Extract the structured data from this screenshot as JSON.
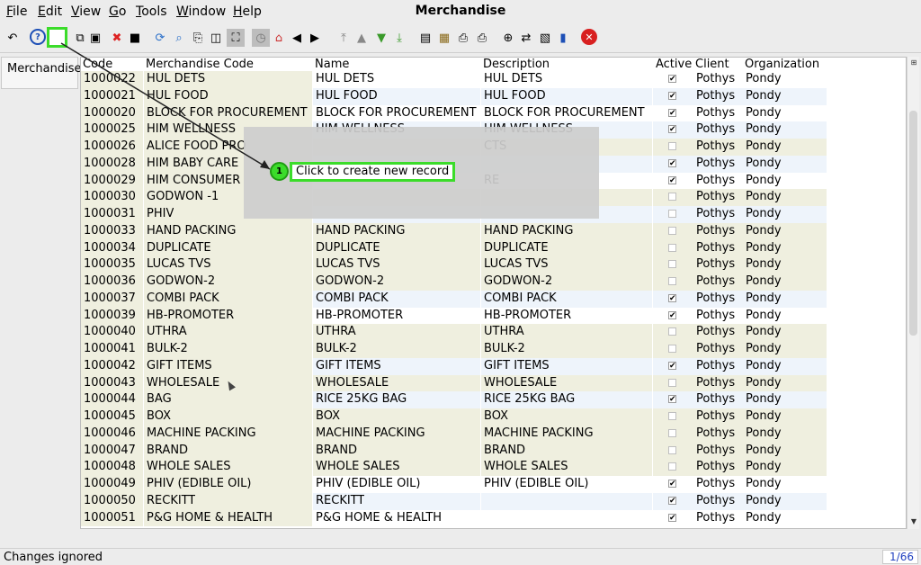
{
  "window": {
    "title": "Merchandise"
  },
  "menu": [
    {
      "label": "File",
      "key": "F",
      "rest": "ile"
    },
    {
      "label": "Edit",
      "key": "E",
      "rest": "dit"
    },
    {
      "label": "View",
      "key": "V",
      "rest": "iew"
    },
    {
      "label": "Go",
      "key": "G",
      "rest": "o"
    },
    {
      "label": "Tools",
      "key": "T",
      "rest": "ools"
    },
    {
      "label": "Window",
      "key": "W",
      "rest": "indow"
    },
    {
      "label": "Help",
      "key": "H",
      "rest": "elp"
    }
  ],
  "toolbar": {
    "icons": [
      "undo-icon",
      "help-icon",
      "new-record-icon",
      "copy-record-icon",
      "delete-icon",
      "delete-x-icon",
      "save-icon",
      "refresh-icon",
      "find-icon",
      "attachment-icon",
      "chat-icon",
      "grid-toggle-icon",
      "history-icon",
      "home-icon",
      "back-icon",
      "forward-icon",
      "first-record-icon",
      "previous-record-icon",
      "next-record-icon",
      "last-record-icon",
      "report-icon",
      "archive-icon",
      "print-preview-icon",
      "print-icon",
      "zoom-icon",
      "workflow-icon",
      "product-icon",
      "request-icon",
      "close-icon"
    ]
  },
  "left_tab": {
    "label": "Merchandise"
  },
  "grid": {
    "columns": [
      "Code",
      "Merchandise Code",
      "Name",
      "Description",
      "Active",
      "Client",
      "Organization"
    ],
    "rows": [
      {
        "code": "1000022",
        "mcode": "HUL DETS",
        "name": "HUL DETS",
        "desc": "HUL DETS",
        "active": true,
        "client": "Pothys",
        "org": "Pondy",
        "style": "plain"
      },
      {
        "code": "1000021",
        "mcode": "HUL FOOD",
        "name": "HUL FOOD",
        "desc": "HUL FOOD",
        "active": true,
        "client": "Pothys",
        "org": "Pondy",
        "style": "alt"
      },
      {
        "code": "1000020",
        "mcode": "BLOCK FOR PROCUREMENT",
        "name": "BLOCK FOR PROCUREMENT",
        "desc": "BLOCK FOR PROCUREMENT",
        "active": true,
        "client": "Pothys",
        "org": "Pondy",
        "style": "plain"
      },
      {
        "code": "1000025",
        "mcode": "HIM WELLNESS",
        "name": "HIM WELLNESS",
        "desc": "HIM WELLNESS",
        "active": true,
        "client": "Pothys",
        "org": "Pondy",
        "style": "alt"
      },
      {
        "code": "1000026",
        "mcode": "ALICE FOOD PRO",
        "name": "",
        "desc": "CTS",
        "active": false,
        "client": "Pothys",
        "org": "Pondy",
        "style": "tan"
      },
      {
        "code": "1000028",
        "mcode": "HIM BABY CARE",
        "name": "",
        "desc": "",
        "active": true,
        "client": "Pothys",
        "org": "Pondy",
        "style": "alt"
      },
      {
        "code": "1000029",
        "mcode": "HIM CONSUMER",
        "name": "",
        "desc": "RE",
        "active": true,
        "client": "Pothys",
        "org": "Pondy",
        "style": "plain"
      },
      {
        "code": "1000030",
        "mcode": "GODWON -1",
        "name": "",
        "desc": "",
        "active": false,
        "client": "Pothys",
        "org": "Pondy",
        "style": "tan"
      },
      {
        "code": "1000031",
        "mcode": "PHIV",
        "name": "",
        "desc": "",
        "active": false,
        "client": "Pothys",
        "org": "Pondy",
        "style": "alt"
      },
      {
        "code": "1000033",
        "mcode": "HAND PACKING",
        "name": "HAND PACKING",
        "desc": "HAND PACKING",
        "active": false,
        "client": "Pothys",
        "org": "Pondy",
        "style": "tan"
      },
      {
        "code": "1000034",
        "mcode": "DUPLICATE",
        "name": "DUPLICATE",
        "desc": "DUPLICATE",
        "active": false,
        "client": "Pothys",
        "org": "Pondy",
        "style": "tan"
      },
      {
        "code": "1000035",
        "mcode": "LUCAS TVS",
        "name": "LUCAS TVS",
        "desc": "LUCAS TVS",
        "active": false,
        "client": "Pothys",
        "org": "Pondy",
        "style": "tan"
      },
      {
        "code": "1000036",
        "mcode": "GODWON-2",
        "name": "GODWON-2",
        "desc": "GODWON-2",
        "active": false,
        "client": "Pothys",
        "org": "Pondy",
        "style": "tan"
      },
      {
        "code": "1000037",
        "mcode": "COMBI PACK",
        "name": "COMBI PACK",
        "desc": "COMBI PACK",
        "active": true,
        "client": "Pothys",
        "org": "Pondy",
        "style": "alt"
      },
      {
        "code": "1000039",
        "mcode": "HB-PROMOTER",
        "name": "HB-PROMOTER",
        "desc": "HB-PROMOTER",
        "active": true,
        "client": "Pothys",
        "org": "Pondy",
        "style": "plain"
      },
      {
        "code": "1000040",
        "mcode": "UTHRA",
        "name": "UTHRA",
        "desc": "UTHRA",
        "active": false,
        "client": "Pothys",
        "org": "Pondy",
        "style": "tan"
      },
      {
        "code": "1000041",
        "mcode": "BULK-2",
        "name": "BULK-2",
        "desc": "BULK-2",
        "active": false,
        "client": "Pothys",
        "org": "Pondy",
        "style": "tan"
      },
      {
        "code": "1000042",
        "mcode": "GIFT ITEMS",
        "name": "GIFT ITEMS",
        "desc": "GIFT ITEMS",
        "active": true,
        "client": "Pothys",
        "org": "Pondy",
        "style": "alt"
      },
      {
        "code": "1000043",
        "mcode": "WHOLESALE",
        "name": "WHOLESALE",
        "desc": "WHOLESALE",
        "active": false,
        "client": "Pothys",
        "org": "Pondy",
        "style": "tan"
      },
      {
        "code": "1000044",
        "mcode": "BAG",
        "name": "RICE 25KG BAG",
        "desc": "RICE 25KG BAG",
        "active": true,
        "client": "Pothys",
        "org": "Pondy",
        "style": "alt"
      },
      {
        "code": "1000045",
        "mcode": "BOX",
        "name": "BOX",
        "desc": "BOX",
        "active": false,
        "client": "Pothys",
        "org": "Pondy",
        "style": "tan"
      },
      {
        "code": "1000046",
        "mcode": "MACHINE PACKING",
        "name": "MACHINE PACKING",
        "desc": "MACHINE PACKING",
        "active": false,
        "client": "Pothys",
        "org": "Pondy",
        "style": "tan"
      },
      {
        "code": "1000047",
        "mcode": "BRAND",
        "name": "BRAND",
        "desc": "BRAND",
        "active": false,
        "client": "Pothys",
        "org": "Pondy",
        "style": "tan"
      },
      {
        "code": "1000048",
        "mcode": "WHOLE SALES",
        "name": "WHOLE SALES",
        "desc": "WHOLE SALES",
        "active": false,
        "client": "Pothys",
        "org": "Pondy",
        "style": "tan"
      },
      {
        "code": "1000049",
        "mcode": "PHIV (EDIBLE OIL)",
        "name": "PHIV (EDIBLE OIL)",
        "desc": "PHIV (EDIBLE OIL)",
        "active": true,
        "client": "Pothys",
        "org": "Pondy",
        "style": "plain"
      },
      {
        "code": "1000050",
        "mcode": "RECKITT",
        "name": "RECKITT",
        "desc": "",
        "active": true,
        "client": "Pothys",
        "org": "Pondy",
        "style": "alt"
      },
      {
        "code": "1000051",
        "mcode": "P&G HOME & HEALTH",
        "name": "P&G HOME & HEALTH",
        "desc": "",
        "active": true,
        "client": "Pothys",
        "org": "Pondy",
        "style": "plain"
      }
    ]
  },
  "callout": {
    "step": "1",
    "text": "Click to create new record"
  },
  "status": {
    "message": "Changes ignored",
    "count": "1/66"
  },
  "colors": {
    "highlight": "#3bdc2a",
    "tan": "#efefdf",
    "alt": "#eef4fb",
    "count_text": "#1f3fbf"
  }
}
